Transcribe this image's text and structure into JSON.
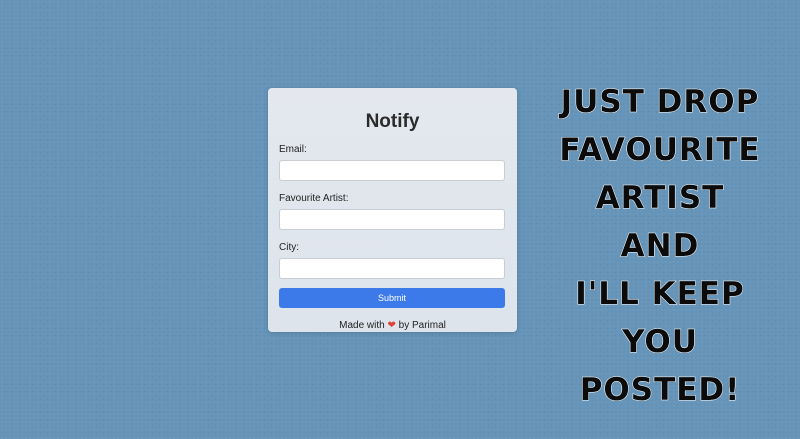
{
  "form": {
    "title": "Notify",
    "fields": [
      {
        "label": "Email:",
        "value": "",
        "placeholder": ""
      },
      {
        "label": "Favourite Artist:",
        "value": "",
        "placeholder": ""
      },
      {
        "label": "City:",
        "value": "",
        "placeholder": ""
      }
    ],
    "submit_label": "Submit",
    "footer": {
      "prefix": "Made with",
      "icon": "heart-icon",
      "icon_glyph": "❤",
      "suffix": "by Parimal"
    }
  },
  "promo": {
    "lines": [
      "JUST DROP",
      "FAVOURITE",
      "ARTIST",
      "AND",
      "I'LL KEEP",
      "YOU",
      "POSTED!"
    ]
  },
  "colors": {
    "background": "#6594b8",
    "card": "#e2e7ed",
    "button": "#3b7ae8",
    "heart": "#e0413a",
    "promo_text": "#0b0b0b"
  }
}
